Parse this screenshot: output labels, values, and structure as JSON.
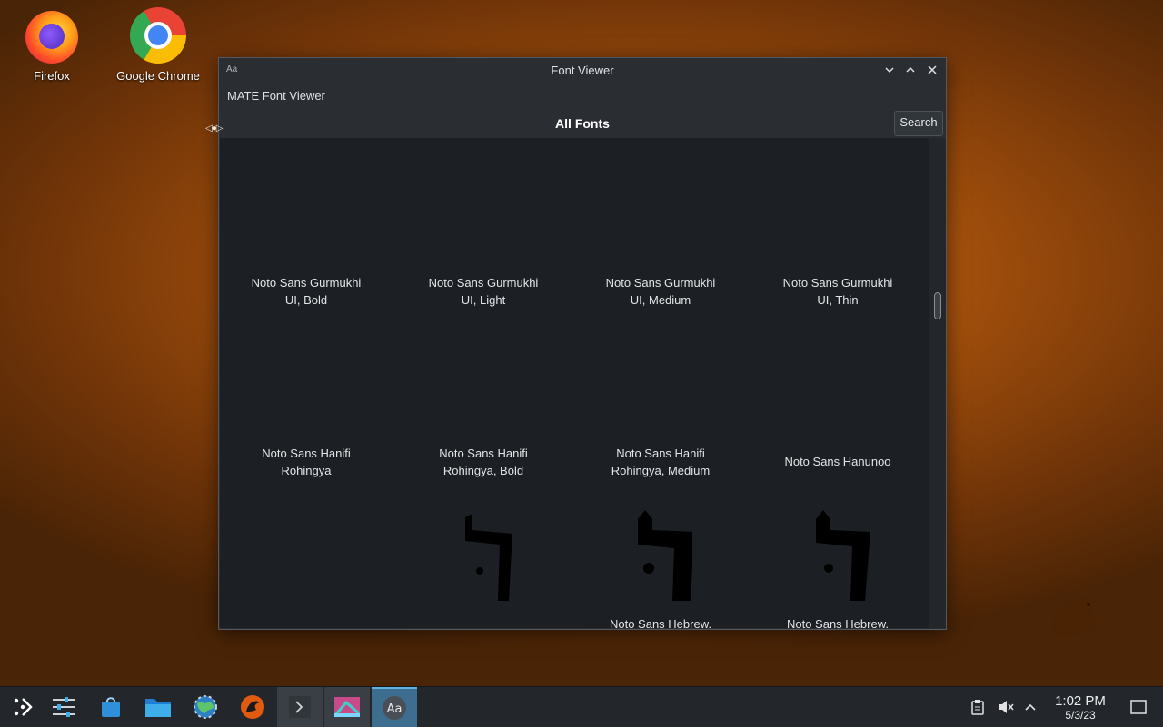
{
  "desktop": {
    "icons": [
      {
        "label": "Firefox",
        "icon": "firefox-icon"
      },
      {
        "label": "Google Chrome",
        "icon": "chrome-icon"
      }
    ]
  },
  "window": {
    "app_icon_text": "Aa",
    "title": "Font Viewer",
    "menubar_title": "MATE Font Viewer",
    "heading": "All Fonts",
    "search_label": "Search",
    "controls": {
      "minimize": "minimize-icon",
      "maximize": "maximize-icon",
      "close": "close-icon"
    }
  },
  "fonts": {
    "row1": [
      "Noto Sans Gurmukhi UI, Bold",
      "Noto Sans Gurmukhi UI, Light",
      "Noto Sans Gurmukhi UI, Medium",
      "Noto Sans Gurmukhi UI, Thin"
    ],
    "row1_lines": [
      [
        "Noto Sans Gurmukhi",
        "UI, Bold"
      ],
      [
        "Noto Sans Gurmukhi",
        "UI, Light"
      ],
      [
        "Noto Sans Gurmukhi",
        "UI, Medium"
      ],
      [
        "Noto Sans Gurmukhi",
        "UI, Thin"
      ]
    ],
    "row2_lines": [
      [
        "Noto Sans Hanifi",
        "Rohingya"
      ],
      [
        "Noto Sans Hanifi",
        "Rohingya, Bold"
      ],
      [
        "Noto Sans Hanifi",
        "Rohingya, Medium"
      ],
      [
        "Noto Sans Hanunoo"
      ]
    ],
    "row3_partial": [
      "Noto Sans Hebrew,",
      "Noto Sans Hebrew,"
    ]
  },
  "taskbar": {
    "items": [
      "application-launcher-icon",
      "system-settings-icon",
      "discover-store-icon",
      "file-manager-icon",
      "settings-globe-icon",
      "retro-game-icon",
      "terminal-icon",
      "image-viewer-icon",
      "font-viewer-icon"
    ],
    "tray": [
      "clipboard-icon",
      "volume-muted-icon",
      "tray-expand-icon"
    ],
    "time": "1:02 PM",
    "date": "5/3/23",
    "show_desktop": "show-desktop-icon"
  }
}
